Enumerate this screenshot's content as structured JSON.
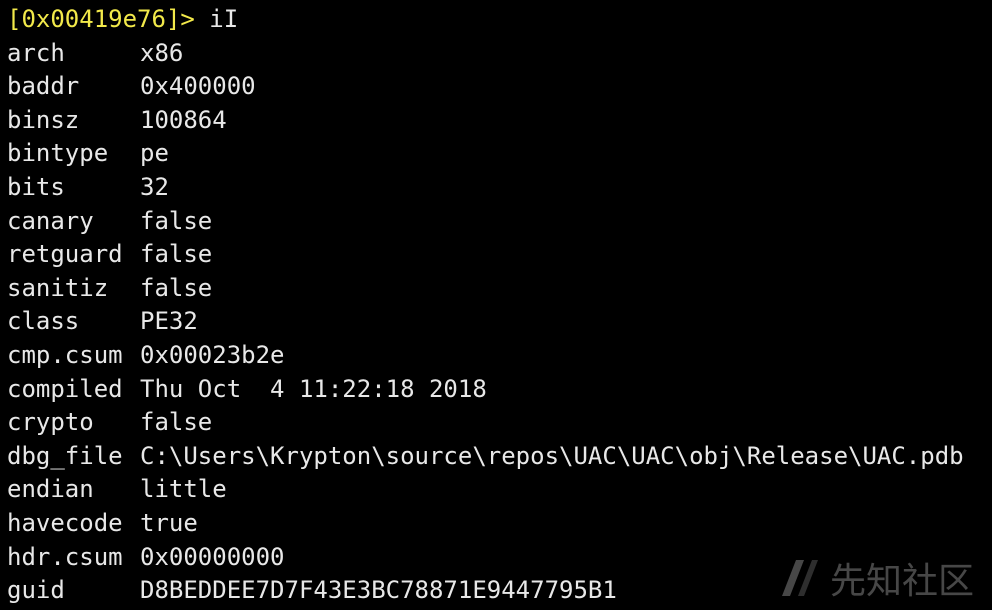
{
  "prompt": {
    "address": "[0x00419e76]>",
    "command": " iI"
  },
  "info": [
    {
      "key": "arch",
      "value": "x86"
    },
    {
      "key": "baddr",
      "value": "0x400000"
    },
    {
      "key": "binsz",
      "value": "100864"
    },
    {
      "key": "bintype",
      "value": "pe"
    },
    {
      "key": "bits",
      "value": "32"
    },
    {
      "key": "canary",
      "value": "false"
    },
    {
      "key": "retguard",
      "value": "false"
    },
    {
      "key": "sanitiz",
      "value": "false"
    },
    {
      "key": "class",
      "value": "PE32"
    },
    {
      "key": "cmp.csum",
      "value": "0x00023b2e"
    },
    {
      "key": "compiled",
      "value": "Thu Oct  4 11:22:18 2018"
    },
    {
      "key": "crypto",
      "value": "false"
    },
    {
      "key": "dbg_file",
      "value": "C:\\Users\\Krypton\\source\\repos\\UAC\\UAC\\obj\\Release\\UAC.pdb"
    },
    {
      "key": "endian",
      "value": "little"
    },
    {
      "key": "havecode",
      "value": "true"
    },
    {
      "key": "hdr.csum",
      "value": "0x00000000"
    },
    {
      "key": "guid",
      "value": "D8BEDDEE7D7F43E3BC78871E9447795B1"
    }
  ],
  "watermark": {
    "text": "先知社区",
    "icon": "xianzhi-logo-icon"
  },
  "colors": {
    "background": "#000000",
    "text": "#e8e8e8",
    "prompt": "#f2e94a"
  }
}
